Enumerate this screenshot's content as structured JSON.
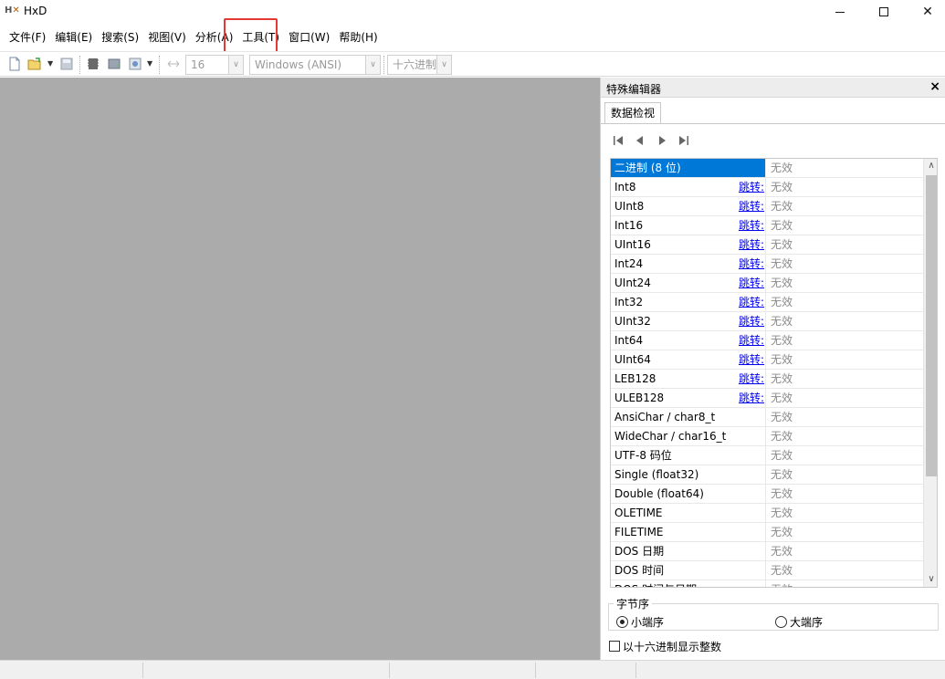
{
  "window": {
    "title": "HxD",
    "icon": "hxd-app-icon"
  },
  "menu": {
    "items": [
      {
        "label": "文件(F)"
      },
      {
        "label": "编辑(E)"
      },
      {
        "label": "搜索(S)"
      },
      {
        "label": "视图(V)"
      },
      {
        "label": "分析(A)"
      },
      {
        "label": "工具(T)"
      },
      {
        "label": "窗口(W)"
      },
      {
        "label": "帮助(H)"
      }
    ],
    "highlighted_item": "工具(T)",
    "highlight_color": "#e53935"
  },
  "toolbar": {
    "bytes_per_row": "16",
    "charset": "Windows (ANSI)",
    "offset_base": "十六进制",
    "icons": [
      "new-file-icon",
      "open-folder-icon",
      "save-icon",
      "ram-icon",
      "disk-icon",
      "disk-image-icon"
    ]
  },
  "panel": {
    "title": "特殊编辑器",
    "tab": "数据检视",
    "rows": [
      {
        "name": "二进制 (8 位)",
        "jump": "",
        "value": "无效",
        "selected": true
      },
      {
        "name": "Int8",
        "jump": "跳转:",
        "value": "无效"
      },
      {
        "name": "UInt8",
        "jump": "跳转:",
        "value": "无效"
      },
      {
        "name": "Int16",
        "jump": "跳转:",
        "value": "无效"
      },
      {
        "name": "UInt16",
        "jump": "跳转:",
        "value": "无效"
      },
      {
        "name": "Int24",
        "jump": "跳转:",
        "value": "无效"
      },
      {
        "name": "UInt24",
        "jump": "跳转:",
        "value": "无效"
      },
      {
        "name": "Int32",
        "jump": "跳转:",
        "value": "无效"
      },
      {
        "name": "UInt32",
        "jump": "跳转:",
        "value": "无效"
      },
      {
        "name": "Int64",
        "jump": "跳转:",
        "value": "无效"
      },
      {
        "name": "UInt64",
        "jump": "跳转:",
        "value": "无效"
      },
      {
        "name": "LEB128",
        "jump": "跳转:",
        "value": "无效"
      },
      {
        "name": "ULEB128",
        "jump": "跳转:",
        "value": "无效"
      },
      {
        "name": "AnsiChar / char8_t",
        "jump": "",
        "value": "无效"
      },
      {
        "name": "WideChar / char16_t",
        "jump": "",
        "value": "无效"
      },
      {
        "name": "UTF-8 码位",
        "jump": "",
        "value": "无效"
      },
      {
        "name": "Single (float32)",
        "jump": "",
        "value": "无效"
      },
      {
        "name": "Double (float64)",
        "jump": "",
        "value": "无效"
      },
      {
        "name": "OLETIME",
        "jump": "",
        "value": "无效"
      },
      {
        "name": "FILETIME",
        "jump": "",
        "value": "无效"
      },
      {
        "name": "DOS 日期",
        "jump": "",
        "value": "无效"
      },
      {
        "name": "DOS 时间",
        "jump": "",
        "value": "无效"
      },
      {
        "name": "DOS 时间与日期",
        "jump": "",
        "value": "无效"
      }
    ],
    "byte_order": {
      "label": "字节序",
      "little_endian": "小端序",
      "big_endian": "大端序",
      "selected": "小端序"
    },
    "hex_int_checkbox": {
      "label": "以十六进制显示整数",
      "checked": false
    }
  }
}
